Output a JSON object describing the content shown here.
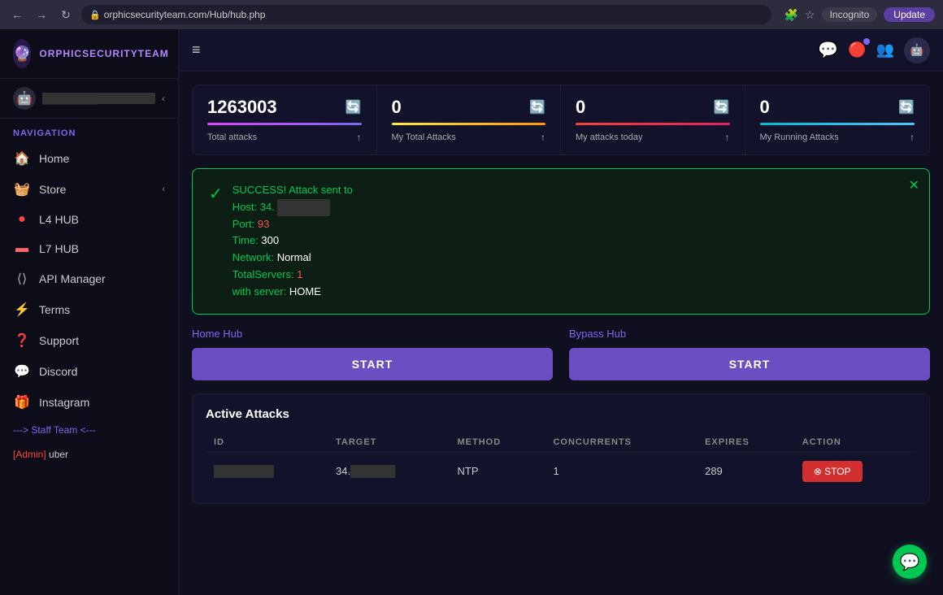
{
  "browser": {
    "nav_back": "←",
    "nav_forward": "→",
    "nav_refresh": "↻",
    "url": "orphicsecurityteam.com/Hub/hub.php",
    "incognito_label": "Incognito",
    "update_label": "Update"
  },
  "sidebar": {
    "logo_icon": "🔮",
    "title": "ORPHICSECURITYTEAM",
    "user_avatar": "🤖",
    "user_name": "████████",
    "collapse_icon": "‹",
    "nav_label": "NAVIGATION",
    "items": [
      {
        "icon": "🏠",
        "label": "Home",
        "active": true
      },
      {
        "icon": "🧺",
        "label": "Store",
        "has_arrow": true
      },
      {
        "icon": "🔴",
        "label": "L4 HUB"
      },
      {
        "icon": "🟥",
        "label": "L7 HUB"
      },
      {
        "icon": "⟨⟩",
        "label": "API Manager"
      },
      {
        "icon": "⚡",
        "label": "Terms"
      },
      {
        "icon": "❓",
        "label": "Support"
      },
      {
        "icon": "💬",
        "label": "Discord"
      },
      {
        "icon": "🎁",
        "label": "Instagram"
      }
    ],
    "staff_label": "---> Staff Team <---",
    "admin_bracket_open": "[Admin]",
    "admin_name": " uber"
  },
  "topbar": {
    "menu_icon": "≡"
  },
  "stats": [
    {
      "value": "1263003",
      "label": "Total attacks",
      "bar_class": "stat-bar-pink",
      "arrow": "↑"
    },
    {
      "value": "0",
      "label": "My Total Attacks",
      "bar_class": "stat-bar-yellow",
      "arrow": "↑"
    },
    {
      "value": "0",
      "label": "My attacks today",
      "bar_class": "stat-bar-red",
      "arrow": "↑"
    },
    {
      "value": "0",
      "label": "My Running Attacks",
      "bar_class": "stat-bar-cyan",
      "arrow": "↑"
    }
  ],
  "alert": {
    "message_line1": "SUCCESS! Attack sent to",
    "host_label": "Host: 34.",
    "host_masked": "███████",
    "port_label": "Port:",
    "port_value": "93",
    "time_label": "Time:",
    "time_value": "300",
    "network_label": "Network:",
    "network_value": "Normal",
    "total_servers_label": "TotalServers:",
    "total_servers_value": "1",
    "with_server_label": "with server:",
    "with_server_value": "HOME",
    "close_icon": "✕"
  },
  "hubs": [
    {
      "label": "Home Hub",
      "btn_label": "START"
    },
    {
      "label": "Bypass Hub",
      "btn_label": "START"
    }
  ],
  "attacks_table": {
    "title": "Active Attacks",
    "columns": [
      "ID",
      "TARGET",
      "METHOD",
      "CONCURRENTS",
      "EXPIRES",
      "ACTION"
    ],
    "rows": [
      {
        "id": "████████",
        "target": "34.██████",
        "method": "NTP",
        "concurrents": "1",
        "expires": "289",
        "action_label": "⊗ STOP"
      }
    ]
  },
  "chat": {
    "icon": "💬"
  }
}
